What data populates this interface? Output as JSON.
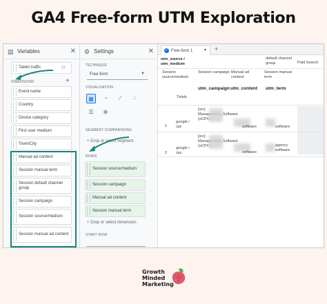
{
  "title": "GA4 Free-form UTM Exploration",
  "variables_panel": {
    "title": "Variables",
    "segment_chip": "Tablet traffic",
    "dimensions_label": "DIMENSIONS",
    "dimensions": [
      "Event name",
      "Country",
      "Device category",
      "First user medium",
      "Town/City",
      "Manual ad content",
      "Session manual term",
      "Session default channel group",
      "Session campaign",
      "Session source/medium",
      "Session manual ad content"
    ]
  },
  "settings_panel": {
    "title": "Settings",
    "technique_label": "TECHNIQUE",
    "technique_value": "Free-form",
    "visualisation_label": "VISUALISATION",
    "segment_comparisons_label": "SEGMENT COMPARISONS",
    "drop_segment": "+ Drop or select segment",
    "rows_label": "ROWS",
    "rows": [
      "Session source/medium",
      "Session campaign",
      "Manual ad content",
      "Session manual term"
    ],
    "drop_dimension": "+ Drop or select dimension",
    "start_row_label": "START ROW"
  },
  "report": {
    "tab_label": "Free-form 1",
    "top_headers": [
      "utm_source / utm_medium",
      "utm_campaign",
      "utm_content",
      "utm_term"
    ],
    "col_headers": [
      "Session source/medium",
      "Session campaign",
      "Manual ad content",
      "Session manual term"
    ],
    "extra_headers": [
      "default channel group",
      "Paid Search"
    ],
    "totals_label": "Totals",
    "rows": [
      {
        "num": "1",
        "source": "google / cpc",
        "campaign": "[src] Management_Software (eCPC)",
        "content": "software",
        "term": "software"
      },
      {
        "num": "2",
        "source": "google / cpc",
        "campaign": "[src] Management_Software (eCPC)",
        "content": "software",
        "term": "agency software"
      }
    ]
  },
  "brand": {
    "line1": "Growth",
    "line2": "Minded",
    "line3": "Marketing"
  },
  "colors": {
    "accent": "#17847b",
    "chip_mark": "#8fb58a",
    "brand_leaf": "#e05a6b",
    "background": "#fdf3ef"
  }
}
